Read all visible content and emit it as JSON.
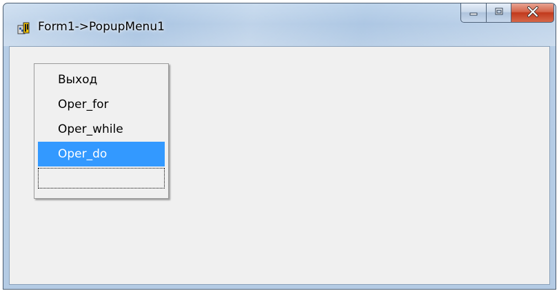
{
  "window": {
    "title": "Form1->PopupMenu1",
    "app_icon": "delphi-app-icon",
    "caption_buttons": [
      {
        "name": "minimize",
        "icon": "minimize-icon"
      },
      {
        "name": "maximize",
        "icon": "maximize-icon"
      },
      {
        "name": "close",
        "icon": "close-icon"
      }
    ]
  },
  "popup_menu": {
    "items": [
      {
        "label": "Выход"
      },
      {
        "label": "Oper_for"
      },
      {
        "label": "Oper_while"
      },
      {
        "label": "Oper_do",
        "selected": true
      },
      {
        "label": ""
      }
    ]
  },
  "colors": {
    "selection": "#3399ff",
    "client_background": "#f0f0f0",
    "close_button": "#c1391c"
  }
}
